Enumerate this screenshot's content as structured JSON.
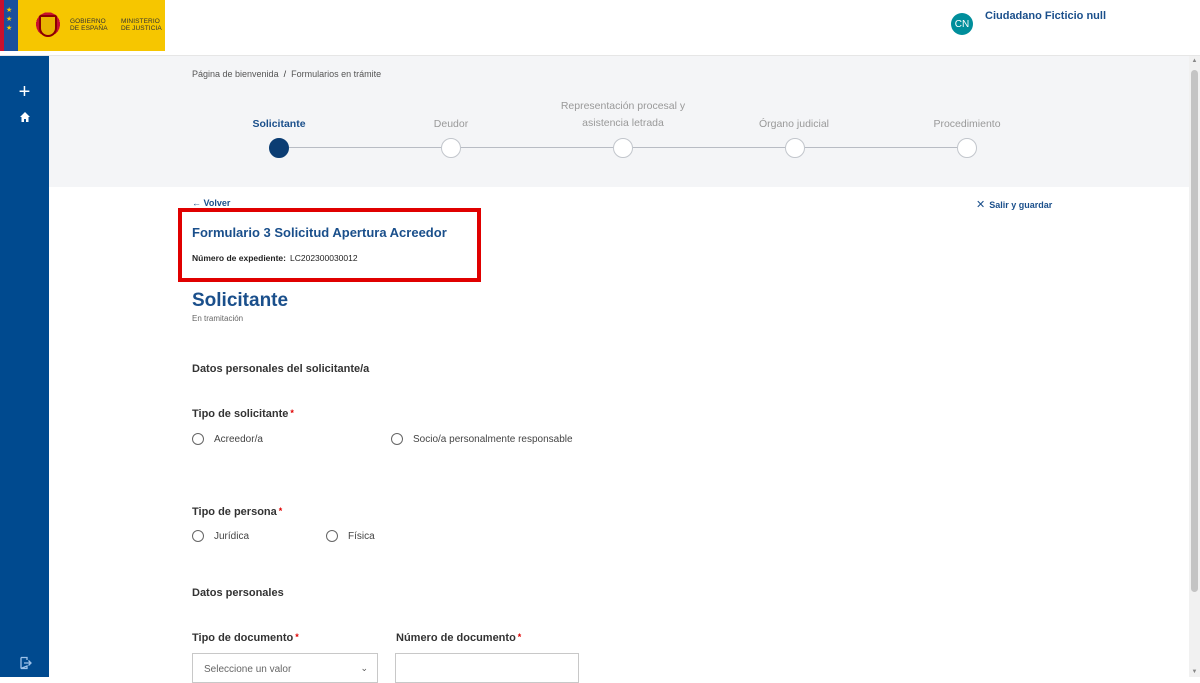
{
  "header": {
    "logo_gov": "GOBIERNO DE ESPAÑA",
    "logo_min": "MINISTERIO DE JUSTICIA",
    "user_initials": "CN",
    "user_name": "Ciudadano Ficticio null"
  },
  "breadcrumb": {
    "home": "Página de bienvenida",
    "separator": "/",
    "current": "Formularios en trámite"
  },
  "stepper": {
    "steps": [
      {
        "label": "Solicitante",
        "active": true
      },
      {
        "label": "Deudor",
        "active": false
      },
      {
        "label": "Representación procesal y asistencia letrada",
        "active": false
      },
      {
        "label": "Órgano judicial",
        "active": false
      },
      {
        "label": "Procedimiento",
        "active": false
      }
    ]
  },
  "actions": {
    "back": "← Volver",
    "exit_save": "Salir y guardar"
  },
  "form": {
    "title": "Formulario 3  Solicitud Apertura Acreedor",
    "expediente_label": "Número de expediente:",
    "expediente_value": "LC202300030012"
  },
  "section": {
    "title": "Solicitante",
    "status": "En tramitación",
    "personal_data_heading": "Datos personales del solicitante/a",
    "tipo_solicitante_label": "Tipo de solicitante",
    "tipo_solicitante_options": [
      "Acreedor/a",
      "Socio/a personalmente responsable"
    ],
    "tipo_persona_label": "Tipo de persona",
    "tipo_persona_options": [
      "Jurídica",
      "Física"
    ],
    "datos_personales_heading": "Datos personales",
    "tipo_documento_label": "Tipo de documento",
    "tipo_documento_placeholder": "Seleccione un valor",
    "numero_documento_label": "Número de documento",
    "required_mark": "*"
  },
  "colors": {
    "brand_blue": "#1a4f8b",
    "sidebar": "#004a8f",
    "highlight": "#e00000",
    "avatar": "#008e9b"
  }
}
